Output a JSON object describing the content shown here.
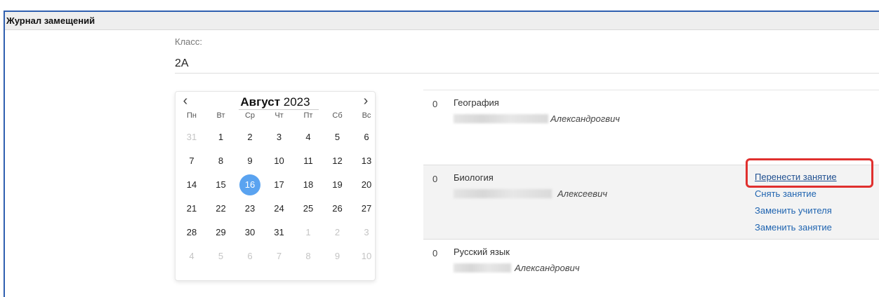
{
  "panel": {
    "title": "Журнал замещений"
  },
  "form": {
    "class_label": "Класс:",
    "class_value": "2А"
  },
  "calendar": {
    "prev_icon": "chevron-left-icon",
    "next_icon": "chevron-right-icon",
    "prev_glyph": "‹",
    "next_glyph": "›",
    "month": "Август",
    "year": "2023",
    "weekdays": [
      "Пн",
      "Вт",
      "Ср",
      "Чт",
      "Пт",
      "Сб",
      "Вс"
    ],
    "weeks": [
      [
        {
          "d": "31",
          "muted": true
        },
        {
          "d": "1"
        },
        {
          "d": "2"
        },
        {
          "d": "3"
        },
        {
          "d": "4"
        },
        {
          "d": "5"
        },
        {
          "d": "6"
        }
      ],
      [
        {
          "d": "7"
        },
        {
          "d": "8"
        },
        {
          "d": "9"
        },
        {
          "d": "10"
        },
        {
          "d": "11"
        },
        {
          "d": "12"
        },
        {
          "d": "13"
        }
      ],
      [
        {
          "d": "14"
        },
        {
          "d": "15"
        },
        {
          "d": "16",
          "selected": true
        },
        {
          "d": "17"
        },
        {
          "d": "18"
        },
        {
          "d": "19"
        },
        {
          "d": "20"
        }
      ],
      [
        {
          "d": "21"
        },
        {
          "d": "22"
        },
        {
          "d": "23"
        },
        {
          "d": "24"
        },
        {
          "d": "25"
        },
        {
          "d": "26"
        },
        {
          "d": "27"
        }
      ],
      [
        {
          "d": "28"
        },
        {
          "d": "29"
        },
        {
          "d": "30"
        },
        {
          "d": "31"
        },
        {
          "d": "1",
          "muted": true
        },
        {
          "d": "2",
          "muted": true
        },
        {
          "d": "3",
          "muted": true
        }
      ],
      [
        {
          "d": "4",
          "muted": true
        },
        {
          "d": "5",
          "muted": true
        },
        {
          "d": "6",
          "muted": true
        },
        {
          "d": "7",
          "muted": true
        },
        {
          "d": "8",
          "muted": true
        },
        {
          "d": "9",
          "muted": true
        },
        {
          "d": "10",
          "muted": true
        }
      ]
    ],
    "selected_color": "#5aa3f0"
  },
  "lessons": [
    {
      "number": "0",
      "subject": "География",
      "teacher_patronymic": "Александрогвич"
    },
    {
      "number": "0",
      "subject": "Биология",
      "teacher_patronymic": "Алексеевич",
      "actions": [
        "Перенести занятие",
        "Снять занятие",
        "Заменить учителя",
        "Заменить занятие"
      ]
    },
    {
      "number": "0",
      "subject": "Русский язык",
      "teacher_patronymic": "Александрович"
    }
  ],
  "colors": {
    "link": "#1f64b0",
    "highlight": "#e0302e",
    "frame": "#2f5fb0"
  }
}
